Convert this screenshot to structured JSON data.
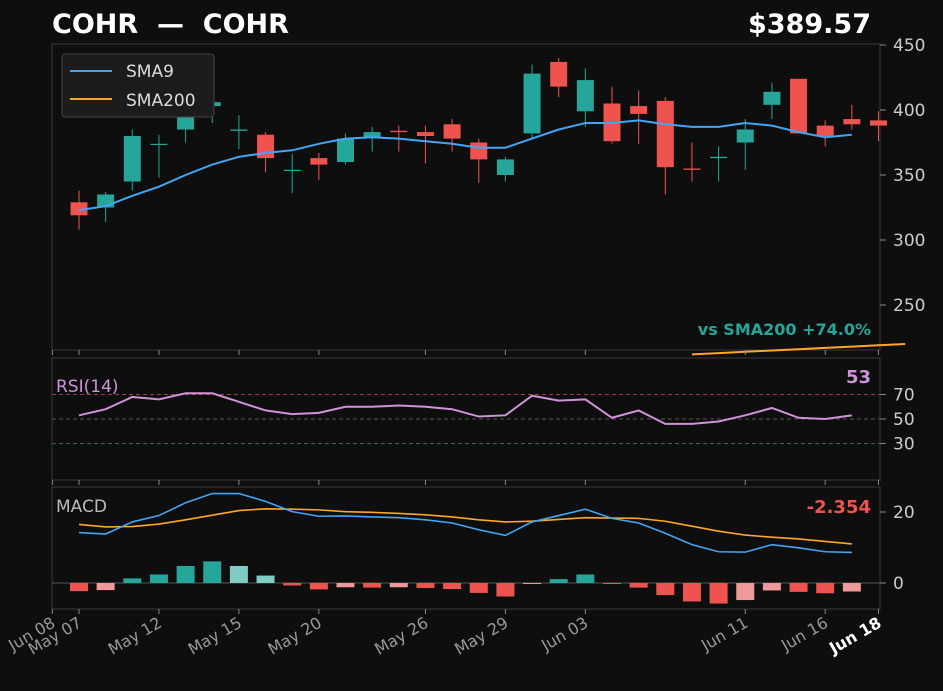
{
  "header": {
    "title": "COHR  —  COHR",
    "price": "$389.57"
  },
  "price_panel": {
    "annotation": "vs SMA200  +74.0%",
    "legend": [
      "SMA9",
      "SMA200"
    ]
  },
  "rsi_panel": {
    "label": "RSI(14)",
    "value": "53"
  },
  "macd_panel": {
    "label": "MACD",
    "value": "-2.354"
  },
  "colors": {
    "up": "#26a69a",
    "down": "#ef5350",
    "sma9": "#42a5f5",
    "sma200": "#ffa726",
    "rsi": "#ce93d8",
    "background": "#0e0e0e"
  },
  "chart_data": [
    {
      "type": "candlestick",
      "title": "COHR  —  COHR",
      "x": [
        "May 07",
        "May 08",
        "May 09",
        "May 12",
        "May 13",
        "May 14",
        "May 15",
        "May 16",
        "May 19",
        "May 20",
        "May 21",
        "May 22",
        "May 23",
        "May 26",
        "May 27",
        "May 28",
        "May 29",
        "May 30",
        "Jun 02",
        "Jun 03",
        "Jun 04",
        "Jun 05",
        "Jun 06",
        "Jun 09",
        "Jun 10",
        "Jun 11",
        "Jun 12",
        "Jun 13",
        "Jun 16",
        "Jun 17",
        "Jun 18"
      ],
      "x_ticks": [
        "May 07",
        "May 12",
        "May 15",
        "May 20",
        "May 26",
        "May 29",
        "Jun 03",
        "Jun 08",
        "Jun 11",
        "Jun 16",
        "Jun 18"
      ],
      "open": [
        329,
        325,
        345,
        374,
        385,
        403,
        384,
        381,
        354,
        363,
        360,
        379,
        384,
        383,
        389,
        375,
        350,
        382,
        437,
        399,
        405,
        403,
        407,
        355,
        363,
        375,
        404,
        424,
        388,
        393,
        392
      ],
      "high": [
        338,
        337,
        385,
        381,
        392,
        414,
        396,
        383,
        366,
        367,
        382,
        387,
        388,
        388,
        393,
        378,
        364,
        435,
        440,
        432,
        418,
        415,
        410,
        375,
        372,
        393,
        421,
        424,
        392,
        404,
        399
      ],
      "low": [
        308,
        314,
        338,
        348,
        375,
        390,
        370,
        352,
        336,
        346,
        358,
        368,
        368,
        359,
        368,
        344,
        345,
        378,
        410,
        387,
        374,
        374,
        335,
        345,
        345,
        354,
        393,
        382,
        372,
        385,
        376
      ],
      "close": [
        319,
        335,
        380,
        374,
        397,
        406,
        385,
        363,
        354,
        358,
        378,
        383,
        383,
        380,
        378,
        362,
        362,
        428,
        418,
        423,
        376,
        397,
        356,
        354,
        364,
        385,
        414,
        382,
        380,
        389,
        388
      ],
      "sma9": [
        323,
        326,
        334,
        341,
        350,
        358,
        364,
        367,
        369,
        374,
        378,
        379,
        378,
        376,
        374,
        371,
        371,
        378,
        385,
        390,
        390,
        392,
        389,
        387,
        387,
        390,
        388,
        383,
        379,
        381
      ],
      "sma200_visible": [
        [
          23,
          212
        ],
        [
          24,
          213
        ],
        [
          25,
          214
        ],
        [
          26,
          215
        ],
        [
          27,
          216
        ],
        [
          28,
          217
        ],
        [
          29,
          218
        ],
        [
          30,
          219
        ],
        [
          31,
          220
        ]
      ],
      "ylim": [
        210,
        450
      ],
      "yticks": [
        250,
        300,
        350,
        400,
        450
      ]
    },
    {
      "type": "line",
      "name": "RSI(14)",
      "values": [
        53,
        58,
        68,
        66,
        71,
        71,
        64,
        57,
        54,
        55,
        60,
        60,
        61,
        60,
        58,
        52,
        53,
        69,
        65,
        66,
        51,
        57,
        46,
        46,
        48,
        53,
        59,
        51,
        50,
        53
      ],
      "ylim": [
        0,
        100
      ],
      "levels": [
        30,
        50,
        70
      ],
      "yticks": [
        30,
        50,
        70
      ]
    },
    {
      "type": "line+bar",
      "name": "MACD",
      "macd": [
        14.2,
        13.8,
        17.2,
        19.0,
        22.6,
        25.2,
        25.2,
        23.0,
        20.1,
        18.8,
        18.9,
        18.6,
        18.4,
        17.8,
        16.9,
        15.0,
        13.4,
        17.2,
        19.0,
        20.8,
        18.2,
        16.9,
        14.0,
        10.8,
        8.8,
        8.7,
        10.8,
        9.9,
        8.8,
        8.6
      ],
      "signal": [
        16.5,
        15.8,
        15.9,
        16.6,
        17.8,
        19.1,
        20.4,
        20.9,
        20.8,
        20.6,
        20.1,
        19.9,
        19.6,
        19.2,
        18.6,
        17.8,
        17.2,
        17.4,
        17.9,
        18.4,
        18.3,
        18.2,
        17.4,
        16.0,
        14.6,
        13.5,
        12.9,
        12.4,
        11.7,
        11.0
      ],
      "histogram": [
        -2.3,
        -2.0,
        1.3,
        2.4,
        4.8,
        6.1,
        4.8,
        2.1,
        -0.7,
        -1.8,
        -1.2,
        -1.3,
        -1.2,
        -1.4,
        -1.7,
        -2.8,
        -3.8,
        -0.2,
        1.1,
        2.4,
        -0.1,
        -1.3,
        -3.4,
        -5.2,
        -5.8,
        -4.8,
        -2.1,
        -2.5,
        -2.9,
        -2.4
      ],
      "ylim": [
        -7,
        28
      ],
      "yticks": [
        0,
        20
      ]
    }
  ]
}
